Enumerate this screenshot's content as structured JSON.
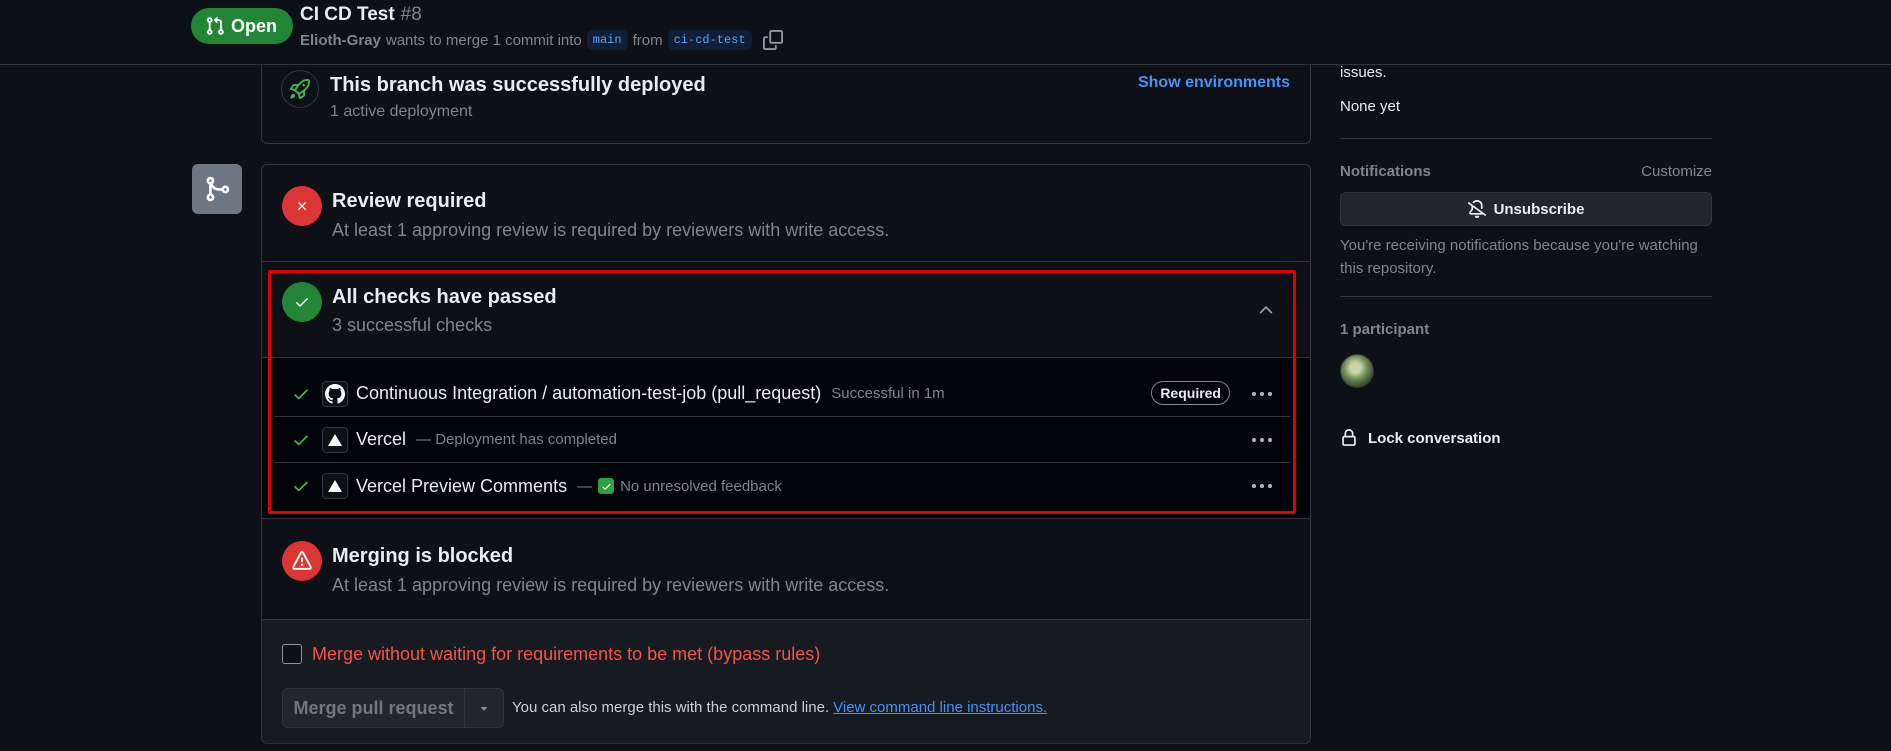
{
  "header": {
    "state": "Open",
    "title": "CI CD Test",
    "number": "#8",
    "author": "Elioth-Gray",
    "merge_text": "wants to merge 1 commit into",
    "base_branch": "main",
    "from_text": "from",
    "head_branch": "ci-cd-test"
  },
  "deployment": {
    "title": "This branch was successfully deployed",
    "subtitle": "1 active deployment",
    "link": "Show environments"
  },
  "review": {
    "title": "Review required",
    "subtitle": "At least 1 approving review is required by reviewers with write access."
  },
  "checks": {
    "title": "All checks have passed",
    "subtitle": "3 successful checks",
    "items": [
      {
        "name": "Continuous Integration / automation-test-job (pull_request)",
        "desc": "Successful in 1m",
        "badge": "Required",
        "icon": "github-icon"
      },
      {
        "name": "Vercel",
        "desc": "— Deployment has completed",
        "icon": "vercel-icon"
      },
      {
        "name": "Vercel Preview Comments",
        "dash": "—",
        "desc": "No unresolved feedback",
        "icon": "vercel-icon"
      }
    ]
  },
  "blocked": {
    "title": "Merging is blocked",
    "subtitle": "At least 1 approving review is required by reviewers with write access."
  },
  "merge": {
    "bypass_label": "Merge without waiting for requirements to be met (bypass rules)",
    "button": "Merge pull request",
    "cli_text": "You can also merge this with the command line.",
    "cli_link": "View command line instructions."
  },
  "sidebar": {
    "issues_tail": "issues.",
    "none_yet": "None yet",
    "notifications_label": "Notifications",
    "customize": "Customize",
    "unsubscribe": "Unsubscribe",
    "notif_desc": "You're receiving notifications because you're watching this repository.",
    "participants": "1 participant",
    "lock": "Lock conversation"
  },
  "colors": {
    "open_green": "#238636",
    "danger_red": "#da3633",
    "link_blue": "#4493f8",
    "highlight_red": "#e00000"
  }
}
